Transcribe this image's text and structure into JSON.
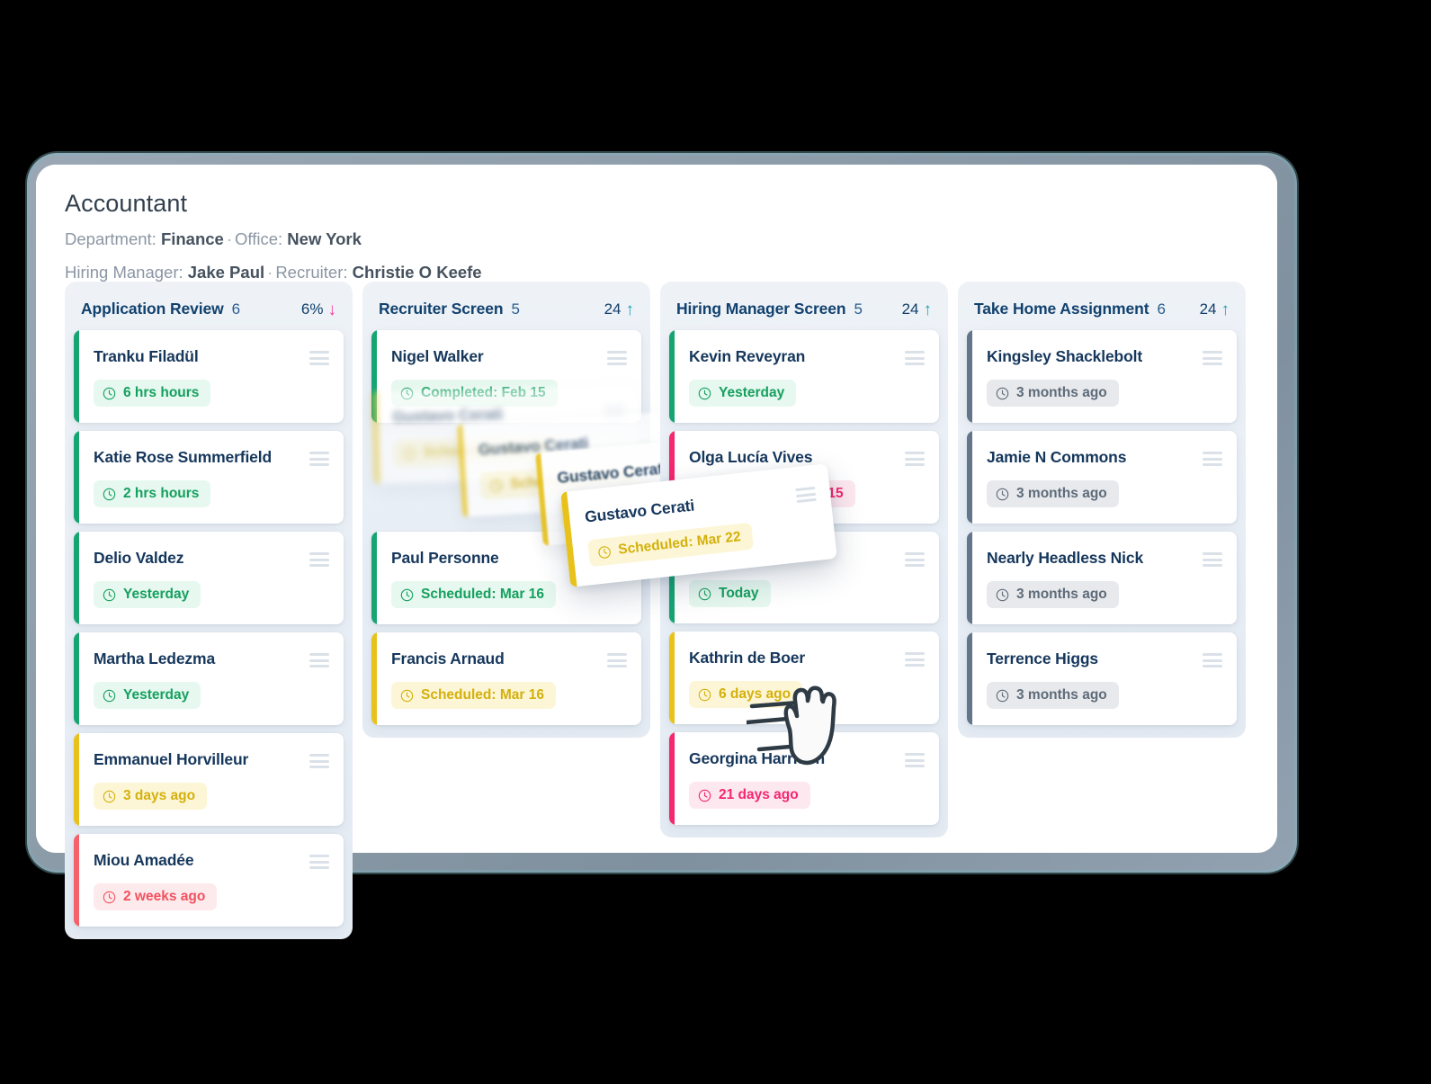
{
  "header": {
    "job_title": "Accountant",
    "department_label": "Department:",
    "department_value": "Finance",
    "office_label": "Office:",
    "office_value": "New York",
    "hiring_manager_label": "Hiring Manager:",
    "hiring_manager_value": "Jake Paul",
    "recruiter_label": "Recruiter:",
    "recruiter_value": "Christie O Keefe",
    "separator": "·"
  },
  "colors": {
    "green": "#16a571",
    "yellow": "#e8c21a",
    "red": "#f4616b",
    "pink": "#f6266f",
    "gray": "#63758a",
    "title_navy": "#11416e",
    "trend_up": "#1fa3b5",
    "trend_down": "#f6399a"
  },
  "columns": [
    {
      "title": "Application Review",
      "count": "6",
      "trend_value": "6%",
      "trend_arrow": "↓",
      "trend_dir": "down",
      "cards": [
        {
          "name": "Tranku Filadül",
          "status": "6 hrs hours",
          "tone": "st-green"
        },
        {
          "name": "Katie Rose Summerfield",
          "status": "2 hrs hours",
          "tone": "st-green"
        },
        {
          "name": "Delio Valdez",
          "status": "Yesterday",
          "tone": "st-green"
        },
        {
          "name": "Martha Ledezma",
          "status": "Yesterday",
          "tone": "st-green"
        },
        {
          "name": "Emmanuel Horvilleur",
          "status": "3  days ago",
          "tone": "st-yellow"
        },
        {
          "name": "Miou Amadée",
          "status": "2 weeks ago",
          "tone": "st-red"
        }
      ]
    },
    {
      "title": "Recruiter Screen",
      "count": "5",
      "trend_value": "24",
      "trend_arrow": "↑",
      "trend_dir": "up",
      "cards": [
        {
          "name": "Nigel Walker",
          "status": "Completed: Feb 15",
          "tone": "st-green"
        },
        {
          "name": "Gustavo Cerati",
          "status": "Scheduled: Mar 22",
          "tone": "st-yellow",
          "dragging": true
        },
        {
          "name": "Paul Personne",
          "status": "Scheduled: Mar 16",
          "tone": "st-green"
        },
        {
          "name": "Francis Arnaud",
          "status": "Scheduled: Mar 16",
          "tone": "st-yellow"
        }
      ]
    },
    {
      "title": "Hiring Manager Screen",
      "count": "5",
      "trend_value": "24",
      "trend_arrow": "↑",
      "trend_dir": "up",
      "cards": [
        {
          "name": "Kevin Reveyran",
          "status": "Yesterday",
          "tone": "st-green"
        },
        {
          "name": "Olga Lucía Vives",
          "status": "Completed: Feb 15",
          "tone": "st-pink"
        },
        {
          "name": "",
          "status": "Today",
          "tone": "st-green"
        },
        {
          "name": "Kathrin de Boer",
          "status": "6 days ago",
          "tone": "st-yellow"
        },
        {
          "name": "Georgina Harrison",
          "status": "21 days ago",
          "tone": "st-pink"
        }
      ]
    },
    {
      "title": "Take Home Assignment",
      "count": "6",
      "trend_value": "24",
      "trend_arrow": "↑",
      "trend_dir": "up",
      "cards": [
        {
          "name": "Kingsley Shacklebolt",
          "status": "3 months ago",
          "tone": "st-gray"
        },
        {
          "name": "Jamie N Commons",
          "status": "3 months ago",
          "tone": "st-gray"
        },
        {
          "name": "Nearly Headless Nick",
          "status": "3 months ago",
          "tone": "st-gray"
        },
        {
          "name": "Terrence Higgs",
          "status": "3 months ago",
          "tone": "st-gray"
        }
      ]
    }
  ],
  "drag": {
    "card_name": "Gustavo Cerati",
    "card_status": "Scheduled: Mar 22",
    "cursor_icon": "grab-hand-cursor"
  },
  "icons": {
    "clock": "clock-icon",
    "drag_handle": "drag-handle-icon"
  }
}
